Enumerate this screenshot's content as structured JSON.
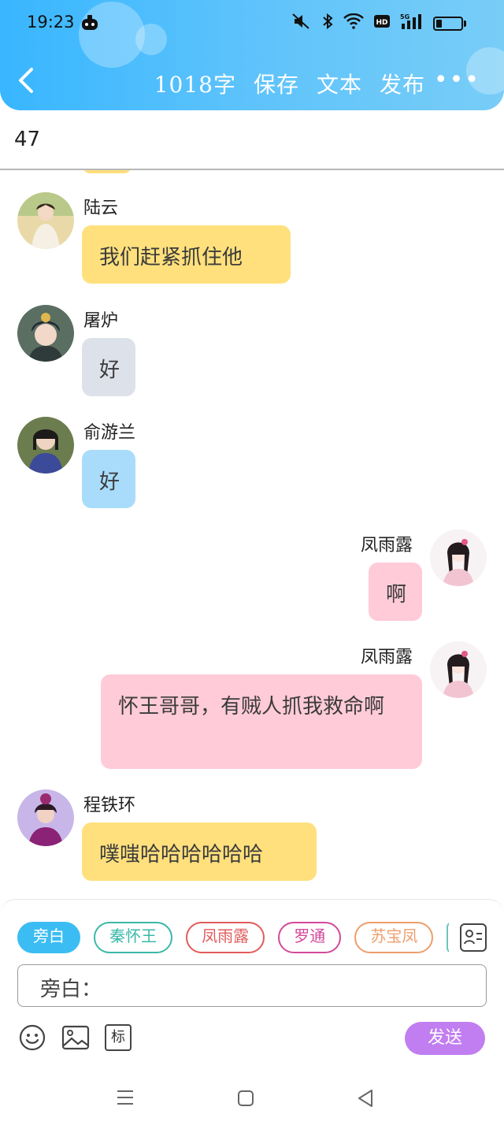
{
  "status_bar": {
    "time": "19:23",
    "network": "5G"
  },
  "header": {
    "word_count": "1018字",
    "save_label": "保存",
    "text_label": "文本",
    "publish_label": "发布",
    "more_label": "•••"
  },
  "title_row": {
    "value": "47"
  },
  "messages": [
    {
      "name": "陆云",
      "text": "我们赶紧抓住他",
      "side": "left",
      "color": "#ffe07d"
    },
    {
      "name": "屠炉",
      "text": "好",
      "side": "left",
      "color": "#dde2ea"
    },
    {
      "name": "俞游兰",
      "text": "好",
      "side": "left",
      "color": "#a9dcfb"
    },
    {
      "name": "凤雨露",
      "text": "啊",
      "side": "right",
      "color": "#ffcbd8"
    },
    {
      "name": "凤雨露",
      "text": "怀王哥哥，有贼人抓我救命啊",
      "side": "right",
      "color": "#ffcbd8"
    },
    {
      "name": "程铁环",
      "text": "噗嗤哈哈哈哈哈哈",
      "side": "left",
      "color": "#ffe07d"
    }
  ],
  "roles": [
    {
      "label": "旁白",
      "color": "#3bbdf3",
      "active": true
    },
    {
      "label": "秦怀王",
      "color": "#3ab8a7",
      "active": false
    },
    {
      "label": "凤雨露",
      "color": "#e25b5b",
      "active": false
    },
    {
      "label": "罗通",
      "color": "#d4489a",
      "active": false
    },
    {
      "label": "苏宝凤",
      "color": "#ef9d6c",
      "active": false
    }
  ],
  "input": {
    "placeholder": "旁白："
  },
  "toolbar": {
    "marker_label": "标",
    "send_label": "发送"
  }
}
